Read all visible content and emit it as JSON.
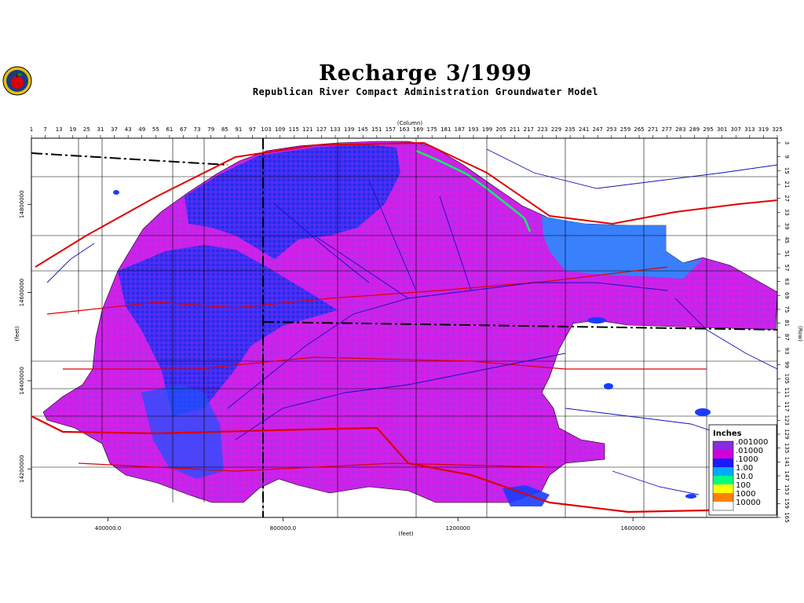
{
  "header": {
    "title": "Recharge 3/1999",
    "subtitle": "Republican River Compact Administration Groundwater Model"
  },
  "chart_data": {
    "type": "heatmap",
    "title": "Recharge 3/1999",
    "subtitle": "Republican River Compact Administration Groundwater Model",
    "top_axis": {
      "label": "(Column)",
      "ticks": [
        "1",
        "7",
        "13",
        "19",
        "25",
        "31",
        "37",
        "43",
        "49",
        "55",
        "61",
        "67",
        "73",
        "79",
        "85",
        "91",
        "97",
        "103",
        "109",
        "115",
        "121",
        "127",
        "133",
        "139",
        "145",
        "151",
        "157",
        "163",
        "169",
        "175",
        "181",
        "187",
        "193",
        "199",
        "205",
        "211",
        "217",
        "223",
        "229",
        "235",
        "241",
        "247",
        "253",
        "259",
        "265",
        "271",
        "277",
        "283",
        "289",
        "295",
        "301",
        "307",
        "313",
        "319",
        "325"
      ]
    },
    "right_axis": {
      "label": "(Row)",
      "ticks": [
        "3",
        "9",
        "15",
        "21",
        "27",
        "33",
        "39",
        "45",
        "51",
        "57",
        "63",
        "69",
        "75",
        "81",
        "87",
        "93",
        "99",
        "105",
        "111",
        "117",
        "123",
        "129",
        "135",
        "141",
        "147",
        "153",
        "159",
        "165"
      ]
    },
    "bottom_axis": {
      "label": "(feet)",
      "ticks": [
        "400000.0",
        "800000.0",
        "1200000",
        "1600000"
      ],
      "values": [
        400000,
        800000,
        1200000,
        1600000
      ],
      "range": [
        225000,
        1930000
      ]
    },
    "left_axis": {
      "label": "(feet)",
      "ticks": [
        "14800000",
        "14600000",
        "14400000",
        "14200000"
      ],
      "values": [
        14800000,
        14600000,
        14400000,
        14200000
      ],
      "range": [
        14090000,
        14950000
      ]
    },
    "legend": {
      "title": "Inches",
      "placement": "bottom-right",
      "entries": [
        {
          "label": ".001000",
          "color": "#8a2be2"
        },
        {
          "label": ".01000",
          "color": "#d000d8"
        },
        {
          "label": ".1000",
          "color": "#1a1aff"
        },
        {
          "label": "1.00",
          "color": "#00aaff"
        },
        {
          "label": "10.0",
          "color": "#00ff80"
        },
        {
          "label": "100",
          "color": "#ffff00"
        },
        {
          "label": "1000",
          "color": "#ff8000"
        },
        {
          "label": "10000",
          "color": "#ffffff"
        }
      ]
    },
    "colors": {
      "dominant": "#cc22ee",
      "secondary": "#a030e0",
      "blue": "#1a3cff",
      "light_blue": "#2090ff",
      "green": "#00ff60",
      "rivers": "#1010c0",
      "roads": "#e00000",
      "boundaries": "#000000"
    }
  }
}
